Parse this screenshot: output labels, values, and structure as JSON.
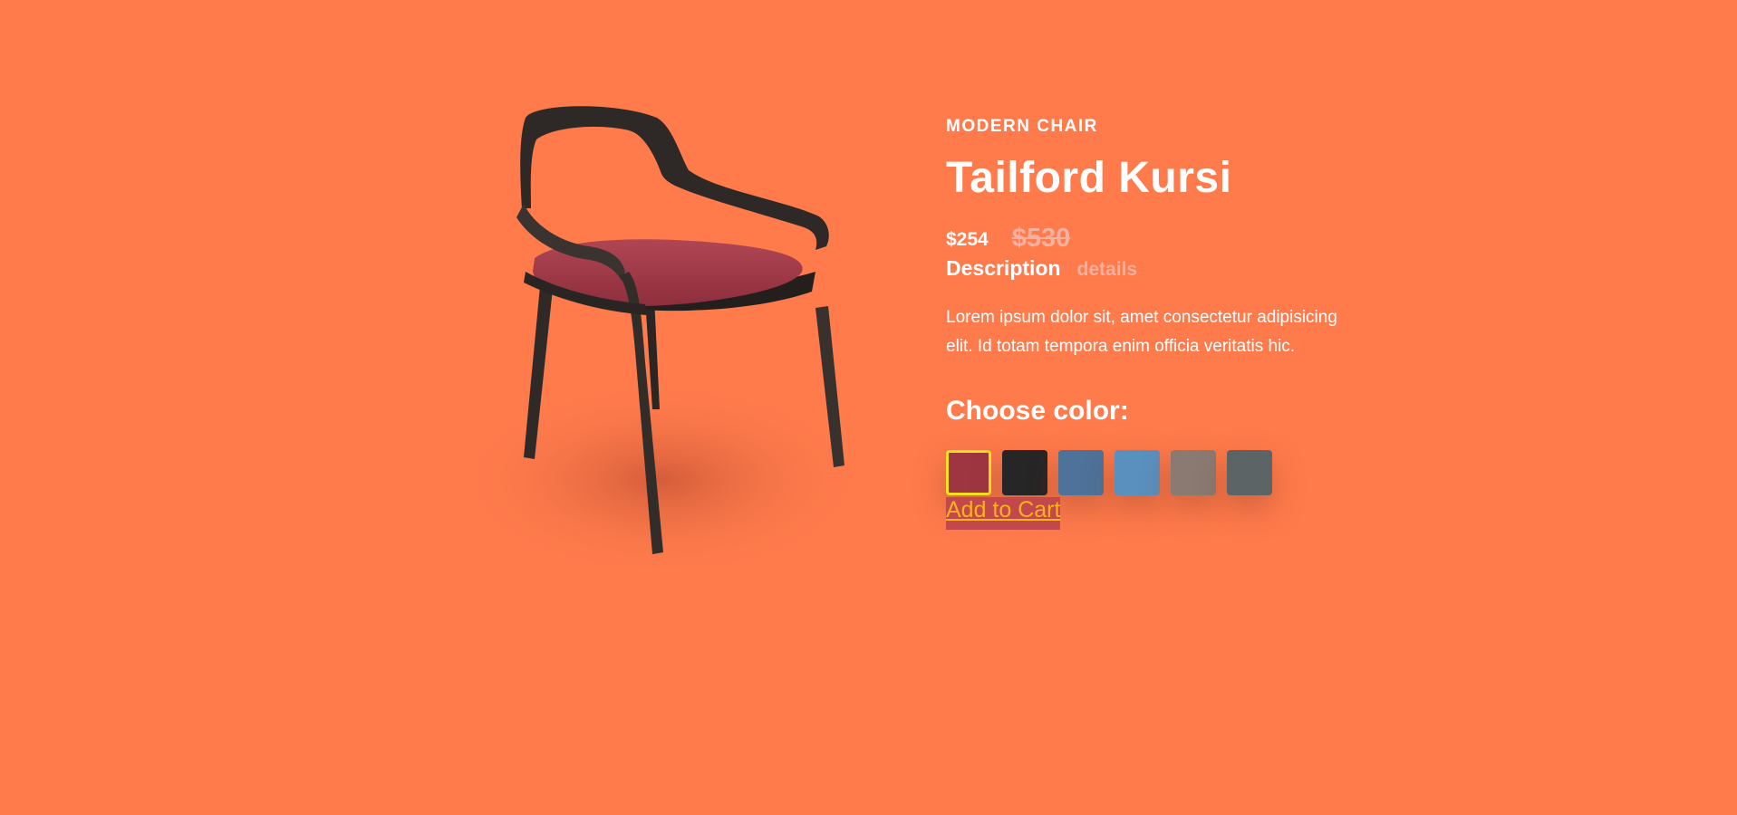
{
  "product": {
    "category": "MODERN CHAIR",
    "name": "Tailford Kursi",
    "price": "$254",
    "old_price": "$530",
    "tabs": [
      {
        "label": "Description",
        "active": true
      },
      {
        "label": "details",
        "active": false
      }
    ],
    "description": "Lorem ipsum dolor sit, amet consectetur adipisicing elit. Id totam tempora enim officia veritatis hic.",
    "color_heading": "Choose color:",
    "colors": [
      {
        "name": "red",
        "hex": "#9E3641",
        "selected": true
      },
      {
        "name": "black",
        "hex": "#262626",
        "selected": false
      },
      {
        "name": "blue-velvet",
        "hex": "#4E7299",
        "selected": false
      },
      {
        "name": "light-blue",
        "hex": "#5A90BE",
        "selected": false
      },
      {
        "name": "taupe",
        "hex": "#8A7A72",
        "selected": false
      },
      {
        "name": "slate",
        "hex": "#5C6466",
        "selected": false
      }
    ],
    "cart_label": "Add to Cart"
  },
  "theme": {
    "background": "#FF7B4C",
    "accent_button": "#C2484C",
    "accent_text": "#FFB21A",
    "selected_border": "#F5E21C"
  }
}
